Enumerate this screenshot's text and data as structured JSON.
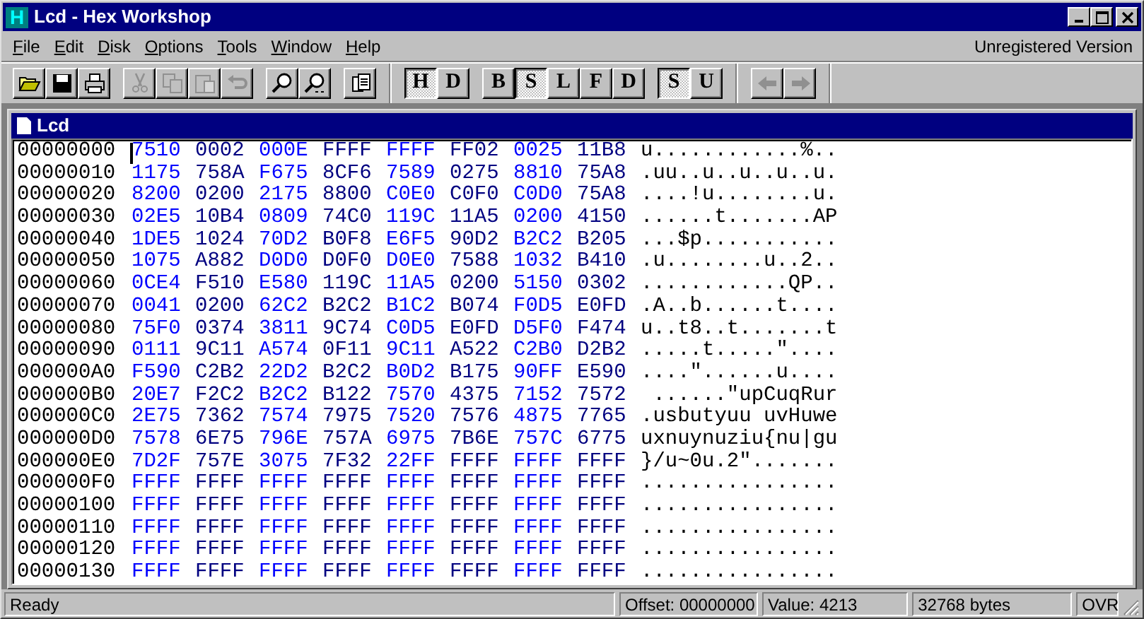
{
  "window": {
    "logo": "H",
    "title": "Lcd - Hex Workshop"
  },
  "menu": [
    {
      "label": "File"
    },
    {
      "label": "Edit"
    },
    {
      "label": "Disk"
    },
    {
      "label": "Options"
    },
    {
      "label": "Tools"
    },
    {
      "label": "Window"
    },
    {
      "label": "Help"
    }
  ],
  "registration": "Unregistered Version",
  "toolbar": [
    {
      "kind": "icons",
      "buttons": [
        {
          "disabled": false
        },
        {
          "disabled": false
        },
        {
          "disabled": false
        }
      ]
    },
    {
      "kind": "icons",
      "buttons": [
        {
          "disabled": true
        },
        {
          "disabled": true
        },
        {
          "disabled": true
        },
        {
          "disabled": true
        }
      ]
    },
    {
      "kind": "icons",
      "buttons": [
        {
          "disabled": false
        },
        {
          "disabled": false
        }
      ]
    },
    {
      "kind": "icons",
      "buttons": [
        {
          "disabled": false
        }
      ]
    },
    {
      "kind": "letters",
      "buttons": [
        {
          "label": "H",
          "pressed": true
        },
        {
          "label": "D",
          "pressed": false
        }
      ]
    },
    {
      "kind": "letters",
      "buttons": [
        {
          "label": "B",
          "pressed": false
        },
        {
          "label": "S",
          "pressed": true
        },
        {
          "label": "L",
          "pressed": false
        },
        {
          "label": "F",
          "pressed": false
        },
        {
          "label": "D",
          "pressed": false
        }
      ]
    },
    {
      "kind": "letters",
      "buttons": [
        {
          "label": "S",
          "pressed": true
        },
        {
          "label": "U",
          "pressed": false
        }
      ]
    },
    {
      "kind": "arrows",
      "buttons": [
        {
          "disabled": true
        },
        {
          "disabled": true
        }
      ]
    }
  ],
  "document": {
    "title": "Lcd",
    "rows": [
      {
        "address": "00000000",
        "words": [
          "7510",
          "0002",
          "000E",
          "FFFF",
          "FFFF",
          "FF02",
          "0025",
          "11B8"
        ],
        "ascii": "u............%.."
      },
      {
        "address": "00000010",
        "words": [
          "1175",
          "758A",
          "F675",
          "8CF6",
          "7589",
          "0275",
          "8810",
          "75A8"
        ],
        "ascii": ".uu..u..u..u..u."
      },
      {
        "address": "00000020",
        "words": [
          "8200",
          "0200",
          "2175",
          "8800",
          "C0E0",
          "C0F0",
          "C0D0",
          "75A8"
        ],
        "ascii": "....!u........u."
      },
      {
        "address": "00000030",
        "words": [
          "02E5",
          "10B4",
          "0809",
          "74C0",
          "119C",
          "11A5",
          "0200",
          "4150"
        ],
        "ascii": "......t.......AP"
      },
      {
        "address": "00000040",
        "words": [
          "1DE5",
          "1024",
          "70D2",
          "B0F8",
          "E6F5",
          "90D2",
          "B2C2",
          "B205"
        ],
        "ascii": "...$p..........."
      },
      {
        "address": "00000050",
        "words": [
          "1075",
          "A882",
          "D0D0",
          "D0F0",
          "D0E0",
          "7588",
          "1032",
          "B410"
        ],
        "ascii": ".u........u..2.."
      },
      {
        "address": "00000060",
        "words": [
          "0CE4",
          "F510",
          "E580",
          "119C",
          "11A5",
          "0200",
          "5150",
          "0302"
        ],
        "ascii": "............QP.."
      },
      {
        "address": "00000070",
        "words": [
          "0041",
          "0200",
          "62C2",
          "B2C2",
          "B1C2",
          "B074",
          "F0D5",
          "E0FD"
        ],
        "ascii": ".A..b......t...."
      },
      {
        "address": "00000080",
        "words": [
          "75F0",
          "0374",
          "3811",
          "9C74",
          "C0D5",
          "E0FD",
          "D5F0",
          "F474"
        ],
        "ascii": "u..t8..t.......t"
      },
      {
        "address": "00000090",
        "words": [
          "0111",
          "9C11",
          "A574",
          "0F11",
          "9C11",
          "A522",
          "C2B0",
          "D2B2"
        ],
        "ascii": ".....t.....\"...."
      },
      {
        "address": "000000A0",
        "words": [
          "F590",
          "C2B2",
          "22D2",
          "B2C2",
          "B0D2",
          "B175",
          "90FF",
          "E590"
        ],
        "ascii": "....\"......u...."
      },
      {
        "address": "000000B0",
        "words": [
          "20E7",
          "F2C2",
          "B2C2",
          "B122",
          "7570",
          "4375",
          "7152",
          "7572"
        ],
        "ascii": " ......\"upCuqRur"
      },
      {
        "address": "000000C0",
        "words": [
          "2E75",
          "7362",
          "7574",
          "7975",
          "7520",
          "7576",
          "4875",
          "7765"
        ],
        "ascii": ".usbutyuu uvHuwe"
      },
      {
        "address": "000000D0",
        "words": [
          "7578",
          "6E75",
          "796E",
          "757A",
          "6975",
          "7B6E",
          "757C",
          "6775"
        ],
        "ascii": "uxnuynuziu{nu|gu"
      },
      {
        "address": "000000E0",
        "words": [
          "7D2F",
          "757E",
          "3075",
          "7F32",
          "22FF",
          "FFFF",
          "FFFF",
          "FFFF"
        ],
        "ascii": "}/u~0u.2\"......."
      },
      {
        "address": "000000F0",
        "words": [
          "FFFF",
          "FFFF",
          "FFFF",
          "FFFF",
          "FFFF",
          "FFFF",
          "FFFF",
          "FFFF"
        ],
        "ascii": "................"
      },
      {
        "address": "00000100",
        "words": [
          "FFFF",
          "FFFF",
          "FFFF",
          "FFFF",
          "FFFF",
          "FFFF",
          "FFFF",
          "FFFF"
        ],
        "ascii": "................"
      },
      {
        "address": "00000110",
        "words": [
          "FFFF",
          "FFFF",
          "FFFF",
          "FFFF",
          "FFFF",
          "FFFF",
          "FFFF",
          "FFFF"
        ],
        "ascii": "................"
      },
      {
        "address": "00000120",
        "words": [
          "FFFF",
          "FFFF",
          "FFFF",
          "FFFF",
          "FFFF",
          "FFFF",
          "FFFF",
          "FFFF"
        ],
        "ascii": "................"
      },
      {
        "address": "00000130",
        "words": [
          "FFFF",
          "FFFF",
          "FFFF",
          "FFFF",
          "FFFF",
          "FFFF",
          "FFFF",
          "FFFF"
        ],
        "ascii": "................"
      }
    ]
  },
  "status_bar": [
    "Ready",
    "Offset: 00000000",
    "Value: 4213",
    "32768 bytes",
    "OVR"
  ]
}
